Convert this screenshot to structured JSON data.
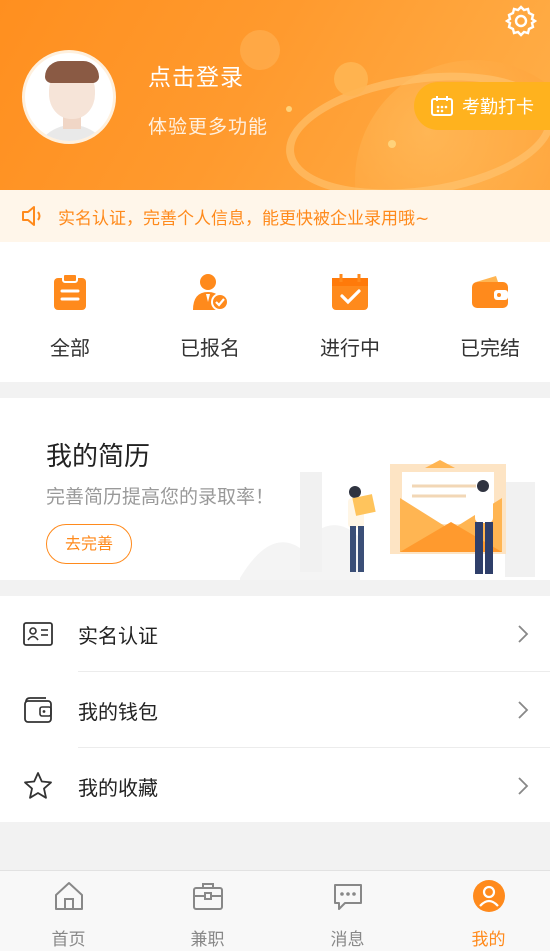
{
  "header": {
    "login_title": "点击登录",
    "login_subtitle": "体验更多功能",
    "checkin_label": "考勤打卡"
  },
  "notice": {
    "text": "实名认证，完善个人信息，能更快被企业录用哦~"
  },
  "status_tabs": [
    {
      "label": "全部",
      "icon": "clipboard-icon"
    },
    {
      "label": "已报名",
      "icon": "registered-user-icon"
    },
    {
      "label": "进行中",
      "icon": "calendar-check-icon"
    },
    {
      "label": "已完结",
      "icon": "wallet-done-icon"
    }
  ],
  "resume": {
    "title": "我的简历",
    "subtitle": "完善简历提高您的录取率！",
    "button_label": "去完善"
  },
  "menu": [
    {
      "label": "实名认证",
      "icon": "id-card-icon"
    },
    {
      "label": "我的钱包",
      "icon": "wallet-icon"
    },
    {
      "label": "我的收藏",
      "icon": "star-icon"
    }
  ],
  "tabbar": [
    {
      "label": "首页",
      "icon": "home-icon"
    },
    {
      "label": "兼职",
      "icon": "briefcase-icon"
    },
    {
      "label": "消息",
      "icon": "message-icon"
    },
    {
      "label": "我的",
      "icon": "profile-icon",
      "active": true
    }
  ],
  "colors": {
    "accent": "#ff8a1c",
    "header_gradient_start": "#ff8f1f",
    "header_gradient_end": "#ffb04a",
    "checkin_bg": "#ffb21e",
    "notice_bg": "#fff6ea"
  }
}
